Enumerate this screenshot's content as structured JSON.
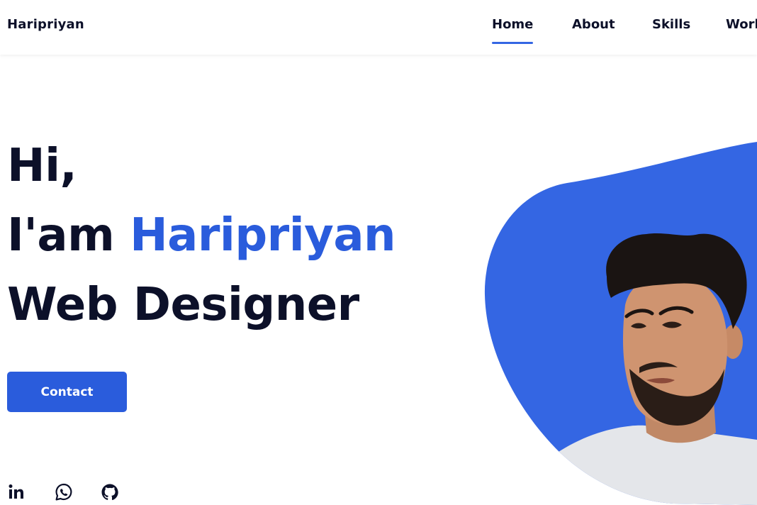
{
  "header": {
    "logo": "Haripriyan",
    "nav": [
      {
        "label": "Home",
        "active": true
      },
      {
        "label": "About",
        "active": false
      },
      {
        "label": "Skills",
        "active": false
      },
      {
        "label": "Work",
        "active": false
      }
    ]
  },
  "hero": {
    "line1": "Hi,",
    "line2_prefix": "I'am",
    "line2_name": "Haripriyan",
    "line3": "Web Designer",
    "cta_label": "Contact"
  },
  "social": [
    {
      "icon": "linkedin-icon"
    },
    {
      "icon": "whatsapp-icon"
    },
    {
      "icon": "github-icon"
    }
  ],
  "colors": {
    "accent": "#2a5cdc",
    "blob": "#3466e3",
    "heading": "#0c1029"
  }
}
